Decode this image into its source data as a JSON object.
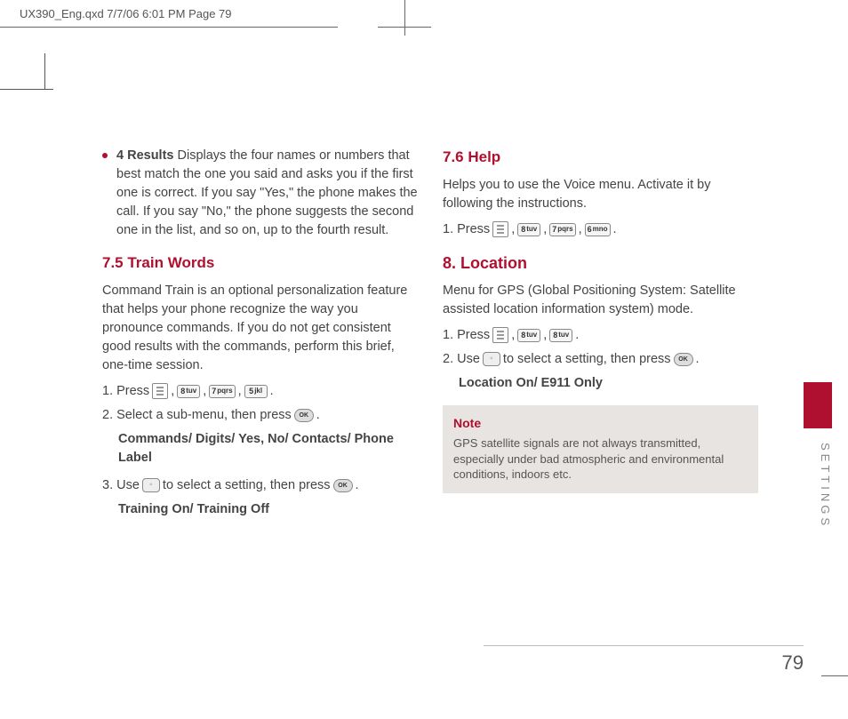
{
  "slug": "UX390_Eng.qxd  7/7/06  6:01 PM  Page 79",
  "left": {
    "bullet": {
      "title": "4 Results",
      "text": " Displays the four names or numbers that best match the one you said and asks you if the first one is correct. If you say \"Yes,\" the phone makes the call. If you say \"No,\" the phone suggests the second one in the list, and so on, up to the fourth result."
    },
    "h75": "7.5 Train Words",
    "p75": "Command Train is an optional personalization feature that helps your phone recognize the way you pronounce commands. If you do not get consistent good results with the commands, perform this brief, one-time session.",
    "s1a": "1. Press ",
    "s1b": ", ",
    "s1c": ", ",
    "s1d": ", ",
    "s1e": " .",
    "k75": {
      "k2": "tuv",
      "k3": "pqrs",
      "k4": "jkl"
    },
    "s2a": "2. Select a sub-menu, then press ",
    "s2b": " .",
    "opts2": "Commands/ Digits/ Yes, No/ Contacts/ Phone Label",
    "s3a": "3. Use ",
    "s3b": " to select a setting, then press ",
    "s3c": " .",
    "opts3": "Training On/ Training Off"
  },
  "right": {
    "h76": "7.6 Help",
    "p76": "Helps you to use the Voice menu. Activate it by following the instructions.",
    "s76a": "1. Press ",
    "s76b": ", ",
    "s76c": ", ",
    "s76d": ", ",
    "s76e": " .",
    "k76": {
      "k2": "tuv",
      "k3": "pqrs",
      "k4": "mno"
    },
    "h8": "8. Location",
    "p8": "Menu for GPS (Global Positioning System: Satellite assisted location information system) mode.",
    "s8_1a": "1. Press ",
    "s8_1b": ", ",
    "s8_1c": ", ",
    "s8_1d": " .",
    "k8": {
      "k2": "tuv",
      "k3": "tuv"
    },
    "s8_2a": "2. Use ",
    "s8_2b": " to select a setting, then press ",
    "s8_2c": " .",
    "opts8": "Location On/ E911 Only",
    "note_title": "Note",
    "note_body": "GPS satellite signals are not always transmitted, especially under bad atmospheric and environmental conditions, indoors etc."
  },
  "ok_label": "OK",
  "tab": "SETTINGS",
  "pagenum": "79"
}
